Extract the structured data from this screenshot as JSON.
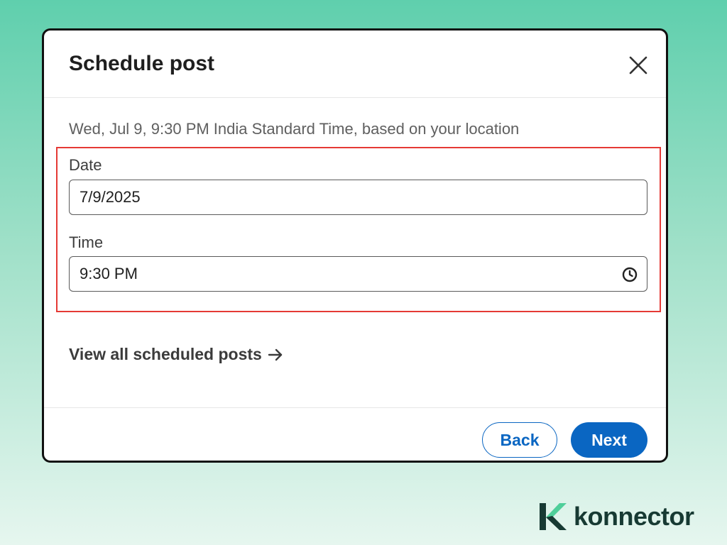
{
  "dialog": {
    "title": "Schedule post",
    "subtitle": "Wed, Jul 9, 9:30 PM India Standard Time, based on your location",
    "date_label": "Date",
    "date_value": "7/9/2025",
    "time_label": "Time",
    "time_value": "9:30 PM",
    "view_all_link": "View all scheduled posts",
    "back_label": "Back",
    "next_label": "Next"
  },
  "icons": {
    "close": "close-icon",
    "clock": "clock-icon",
    "arrow": "arrow-right-icon"
  },
  "brand": {
    "name": "konnector",
    "accent": "#4fcf9a",
    "primary_button": "#0a66c2",
    "highlight": "#e53935"
  }
}
